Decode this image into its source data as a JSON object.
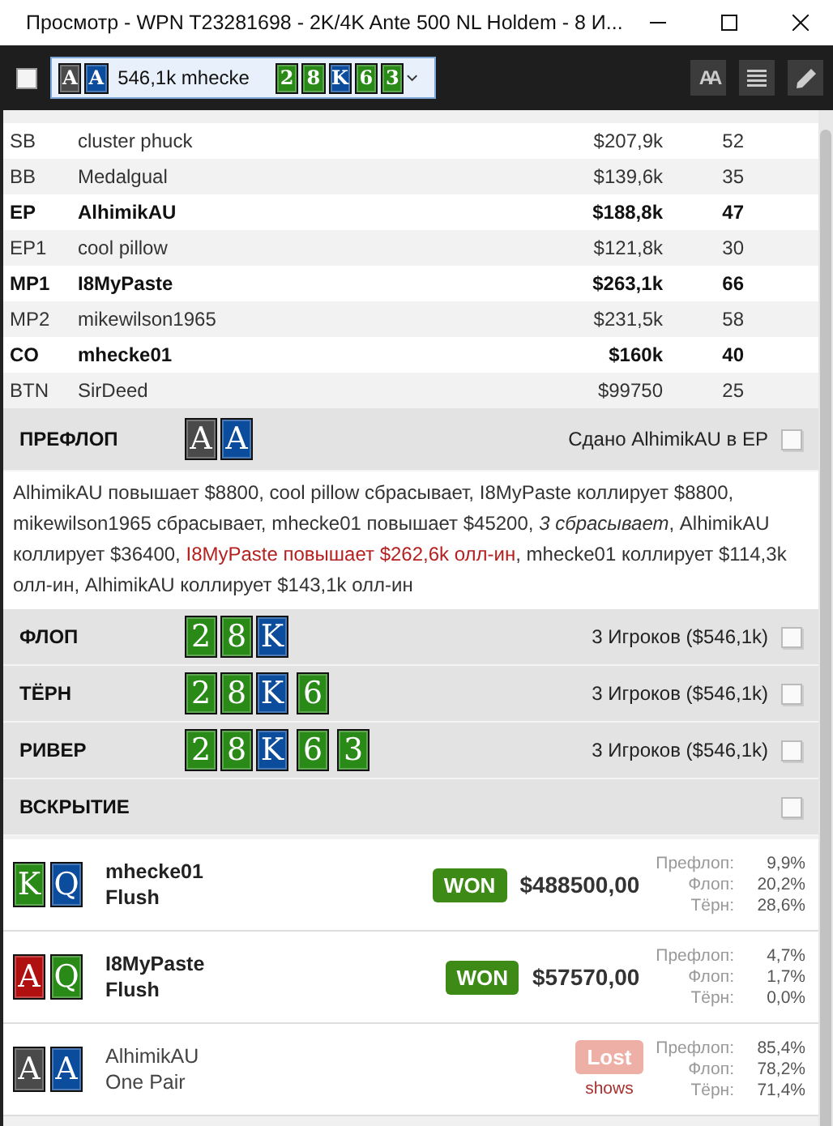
{
  "window": {
    "title": "Просмотр - WPN T23281698 - 2K/4K Ante 500 NL Holdem - 8 И..."
  },
  "toolbar": {
    "checked": false,
    "hand_cards": [
      {
        "rank": "A",
        "color": "#4a4a4a"
      },
      {
        "rank": "A",
        "color": "#0b4c9c"
      }
    ],
    "summary": "546,1k mhecke",
    "board": [
      {
        "rank": "2",
        "color": "#2a8a18"
      },
      {
        "rank": "8",
        "color": "#2a8a18"
      },
      {
        "rank": "K",
        "color": "#0b4c9c"
      },
      {
        "rank": "6",
        "color": "#2a8a18"
      },
      {
        "rank": "3",
        "color": "#2a8a18"
      }
    ],
    "text_size_button": "AA"
  },
  "seats": [
    {
      "position": "SB",
      "name": "cluster phuck",
      "stack": "$207,9k",
      "bb": "52",
      "involved": false
    },
    {
      "position": "BB",
      "name": "Medalgual",
      "stack": "$139,6k",
      "bb": "35",
      "involved": false
    },
    {
      "position": "EP",
      "name": "AlhimikAU",
      "stack": "$188,8k",
      "bb": "47",
      "involved": true
    },
    {
      "position": "EP1",
      "name": "cool pillow",
      "stack": "$121,8k",
      "bb": "30",
      "involved": false
    },
    {
      "position": "MP1",
      "name": "I8MyPaste",
      "stack": "$263,1k",
      "bb": "66",
      "involved": true
    },
    {
      "position": "MP2",
      "name": "mikewilson1965",
      "stack": "$231,5k",
      "bb": "58",
      "involved": false
    },
    {
      "position": "CO",
      "name": "mhecke01",
      "stack": "$160k",
      "bb": "40",
      "involved": true
    },
    {
      "position": "BTN",
      "name": "SirDeed",
      "stack": "$99750",
      "bb": "25",
      "involved": false
    }
  ],
  "streets": [
    {
      "name": "ПРЕФЛОП",
      "cards": [
        {
          "rank": "A",
          "color": "#4a4a4a"
        },
        {
          "rank": "A",
          "color": "#0b4c9c"
        }
      ],
      "info": "Сдано AlhimikAU в EP",
      "checked": false,
      "actions": [
        {
          "kind": "normal",
          "text": "AlhimikAU повышает $8800, cool pillow сбрасывает, I8MyPaste коллирует $8800, mikewilson1965 сбрасывает, mhecke01 повышает $45200, "
        },
        {
          "kind": "italic",
          "text": "3 сбрасывает"
        },
        {
          "kind": "normal",
          "text": ", AlhimikAU коллирует $36400, "
        },
        {
          "kind": "allin",
          "text": "I8MyPaste повышает $262,6k олл-ин"
        },
        {
          "kind": "normal",
          "text": ", mhecke01 коллирует $114,3k олл-ин, AlhimikAU коллирует $143,1k олл-ин"
        }
      ]
    },
    {
      "name": "ФЛОП",
      "cards": [
        {
          "rank": "2",
          "color": "#2a8a18"
        },
        {
          "rank": "8",
          "color": "#2a8a18"
        },
        {
          "rank": "K",
          "color": "#0b4c9c"
        }
      ],
      "info": "3 Игроков ($546,1k)",
      "checked": false
    },
    {
      "name": "ТЁРН",
      "cards": [
        {
          "rank": "2",
          "color": "#2a8a18"
        },
        {
          "rank": "8",
          "color": "#2a8a18"
        },
        {
          "rank": "K",
          "color": "#0b4c9c"
        },
        {
          "rank": "6",
          "color": "#2a8a18"
        }
      ],
      "info": "3 Игроков ($546,1k)",
      "checked": false
    },
    {
      "name": "РИВЕР",
      "cards": [
        {
          "rank": "2",
          "color": "#2a8a18"
        },
        {
          "rank": "8",
          "color": "#2a8a18"
        },
        {
          "rank": "K",
          "color": "#0b4c9c"
        },
        {
          "rank": "6",
          "color": "#2a8a18"
        },
        {
          "rank": "3",
          "color": "#2a8a18"
        }
      ],
      "info": "3 Игроков ($546,1k)",
      "checked": false
    },
    {
      "name": "ВСКРЫТИЕ",
      "checked": false
    }
  ],
  "results": [
    {
      "cards": [
        {
          "rank": "K",
          "color": "#2a8a18"
        },
        {
          "rank": "Q",
          "color": "#0b4c9c"
        }
      ],
      "name": "mhecke01",
      "hand": "Flush",
      "kind": "won",
      "badge": "WON",
      "amount": "$488500,00",
      "equity": [
        {
          "label": "Префлоп:",
          "value": "9,9%"
        },
        {
          "label": "Флоп:",
          "value": "20,2%"
        },
        {
          "label": "Тёрн:",
          "value": "28,6%"
        }
      ]
    },
    {
      "cards": [
        {
          "rank": "A",
          "color": "#b01010"
        },
        {
          "rank": "Q",
          "color": "#2a8a18"
        }
      ],
      "name": "I8MyPaste",
      "hand": "Flush",
      "kind": "won",
      "badge": "WON",
      "amount": "$57570,00",
      "equity": [
        {
          "label": "Префлоп:",
          "value": "4,7%"
        },
        {
          "label": "Флоп:",
          "value": "1,7%"
        },
        {
          "label": "Тёрн:",
          "value": "0,0%"
        }
      ]
    },
    {
      "cards": [
        {
          "rank": "A",
          "color": "#4a4a4a"
        },
        {
          "rank": "A",
          "color": "#0b4c9c"
        }
      ],
      "name": "AlhimikAU",
      "hand": "One Pair",
      "kind": "lost",
      "badge": "Lost",
      "note": "shows",
      "equity": [
        {
          "label": "Префлоп:",
          "value": "85,4%"
        },
        {
          "label": "Флоп:",
          "value": "78,2%"
        },
        {
          "label": "Тёрн:",
          "value": "71,4%"
        }
      ]
    }
  ]
}
